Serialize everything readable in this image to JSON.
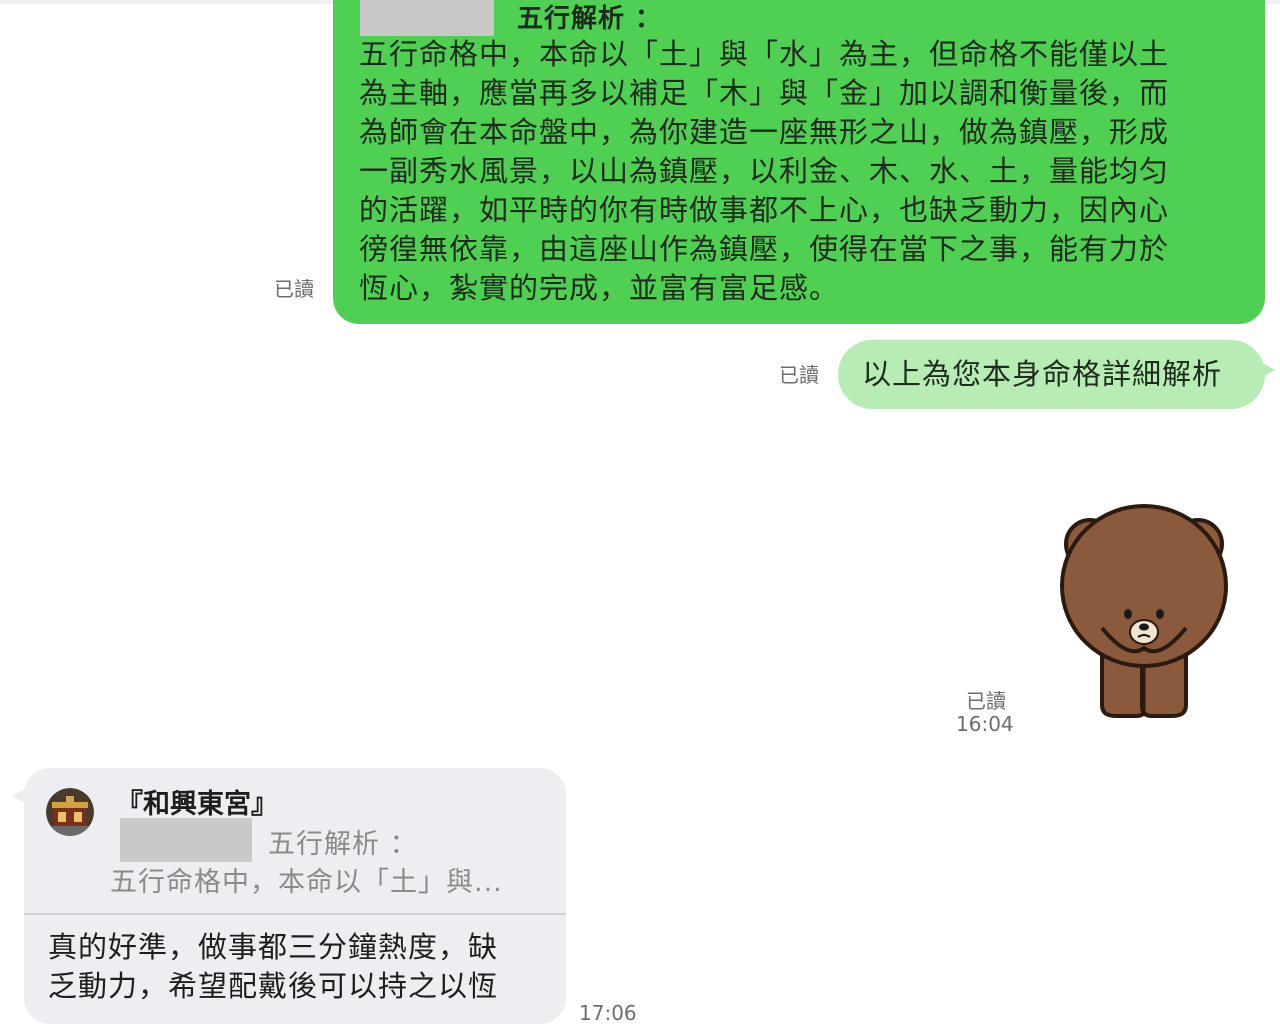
{
  "sent_long": {
    "header_title": "五行解析 ：",
    "body": "五行命格中，本命以「土」與「水」為主，但命格不能僅以土\n為主軸，應當再多以補足「木」與「金」加以調和衡量後，而\n為師會在本命盤中，為你建造一座無形之山，做為鎮壓，形成\n一副秀水風景，以山為鎮壓，以利金、木、水、土，量能均匀\n的活躍，如平時的你有時做事都不上心，也缺乏動力，因內心\n徬徨無依靠，由這座山作為鎮壓，使得在當下之事，能有力於\n恆心，紮實的完成，並富有富足感。",
    "read": "已讀"
  },
  "sent_short": {
    "text": "以上為您本身命格詳細解析",
    "read": "已讀"
  },
  "sticker": {
    "name": "brown-bear-sticker",
    "read": "已讀",
    "time": "16:04"
  },
  "received": {
    "quote_sender": "『和興東宮』",
    "quote_title": "五行解析 ：",
    "quote_excerpt": "五行命格中，本命以「土」與...",
    "text": "真的好準，做事都三分鐘熱度，缺\n乏動力，希望配戴後可以持之以恆",
    "time": "17:06"
  },
  "colors": {
    "sent_bubble": "#4fd052",
    "sent_bubble_light": "#b8ecb5",
    "received_bubble": "#eceef1",
    "meta_text": "#6d6d6d"
  }
}
